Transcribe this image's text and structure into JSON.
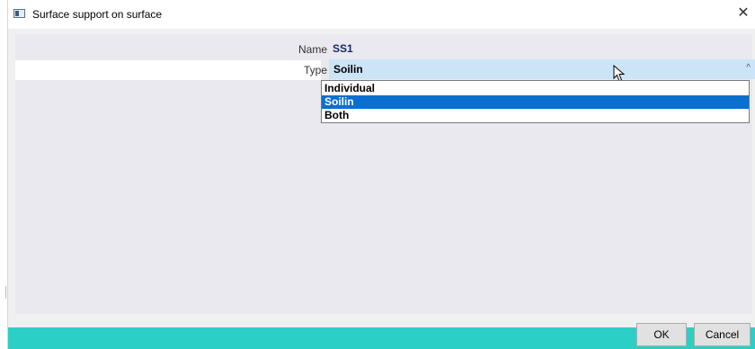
{
  "window": {
    "title": "Surface support on surface",
    "close_glyph": "✕",
    "app_icon": "dialog-window-icon"
  },
  "form": {
    "name_label": "Name",
    "name_value": "SS1",
    "type_label": "Type",
    "type_value": "Soilin",
    "chevron_icon": "chevron-up-icon",
    "chevron_glyph": "^"
  },
  "dropdown": {
    "options": [
      "Individual",
      "Soilin",
      "Both"
    ],
    "selected": "Soilin"
  },
  "buttons": {
    "ok_label": "OK",
    "cancel_label": "Cancel"
  },
  "colors": {
    "accent_footer": "#2ccfc4",
    "select_highlight": "#0a6fcf",
    "combo_background": "#cce4f7"
  }
}
